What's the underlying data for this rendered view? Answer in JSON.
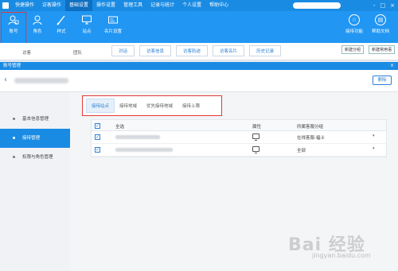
{
  "menubar": {
    "items": [
      "快捷操作",
      "访客操作",
      "基础设置",
      "操作设置",
      "管理工具",
      "记录与统计",
      "个人设置",
      "帮助中心"
    ],
    "active_index": 2,
    "window_controls": [
      "-",
      "□",
      "×"
    ]
  },
  "toolbar": {
    "tools": [
      {
        "label": "账号",
        "icon": "account-icon",
        "selected": true
      },
      {
        "label": "角色",
        "icon": "role-icon"
      },
      {
        "label": "样式",
        "icon": "style-icon"
      },
      {
        "label": "站点",
        "icon": "site-icon"
      },
      {
        "label": "名片设置",
        "icon": "card-icon"
      }
    ],
    "right_tools": [
      {
        "label": "接待功能",
        "icon": "star-icon"
      },
      {
        "label": "帮助文档",
        "icon": "help-icon"
      }
    ]
  },
  "background_table": {
    "col1": "访客",
    "col2": "团队",
    "tabs": [
      "对话",
      "访客信息",
      "访客轨迹",
      "访客名片",
      "历史记录"
    ],
    "buttons": [
      "新建分组",
      "新建常用语"
    ]
  },
  "dialog": {
    "title": "账号管理",
    "close": "×",
    "back": "‹",
    "delete_button": "删除",
    "sidebar": {
      "items": [
        {
          "label": "基本信息管理",
          "active": false
        },
        {
          "label": "接待管理",
          "active": true
        },
        {
          "label": "权限与角色管理",
          "active": false
        }
      ]
    },
    "subtabs": [
      {
        "label": "接待站点",
        "active": true
      },
      {
        "label": "接待地域",
        "active": false
      },
      {
        "label": "优先接待地域",
        "active": false
      },
      {
        "label": "接待上限",
        "active": false
      }
    ],
    "table": {
      "headers": {
        "all": "全选",
        "attribute": "属性",
        "group": "所属客服分组"
      },
      "rows": [
        {
          "group": "在线客服-福士",
          "checked": true
        },
        {
          "group": "全部",
          "checked": true
        }
      ]
    }
  },
  "watermark": {
    "text": "Bai 经验",
    "sub": "jingyan.baidu.com"
  }
}
